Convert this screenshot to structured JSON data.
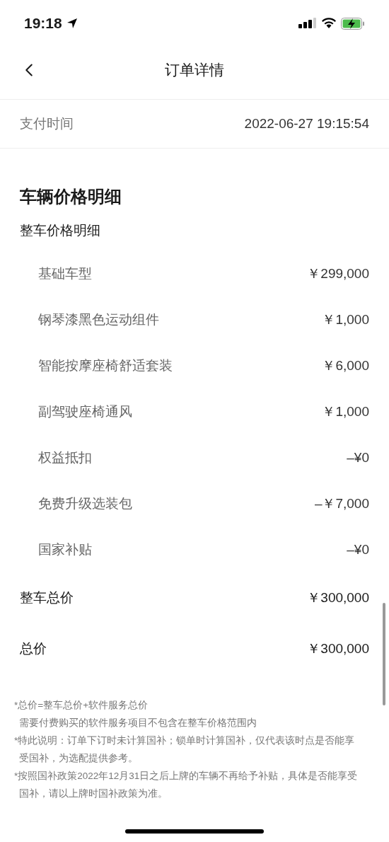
{
  "status_bar": {
    "time": "19:18"
  },
  "nav": {
    "title": "订单详情"
  },
  "payment": {
    "label": "支付时间",
    "value": "2022-06-27 19:15:54"
  },
  "section": {
    "title": "车辆价格明细",
    "subtitle": "整车价格明细",
    "items": [
      {
        "label": "基础车型",
        "value": "￥299,000"
      },
      {
        "label": "钢琴漆黑色运动组件",
        "value": "￥1,000"
      },
      {
        "label": "智能按摩座椅舒适套装",
        "value": "￥6,000"
      },
      {
        "label": "副驾驶座椅通风",
        "value": "￥1,000"
      },
      {
        "label": "权益抵扣",
        "value": "–¥0"
      },
      {
        "label": "免费升级选装包",
        "value": "–￥7,000"
      },
      {
        "label": "国家补贴",
        "value": "–¥0"
      }
    ],
    "totals": [
      {
        "label": "整车总价",
        "value": "￥300,000"
      },
      {
        "label": "总价",
        "value": "￥300,000"
      }
    ]
  },
  "footnotes": [
    {
      "kind": "note",
      "text": "*总价=整车总价+软件服务总价"
    },
    {
      "kind": "continuation",
      "text": "需要付费购买的软件服务项目不包含在整车价格范围内"
    },
    {
      "kind": "note",
      "text": "*特此说明：订单下订时未计算国补；锁单时计算国补，仅代表该时点是否能享受国补，为选配提供参考。"
    },
    {
      "kind": "note",
      "text": "*按照国补政策2022年12月31日之后上牌的车辆不再给予补贴，具体是否能享受国补，请以上牌时国补政策为准。"
    }
  ]
}
